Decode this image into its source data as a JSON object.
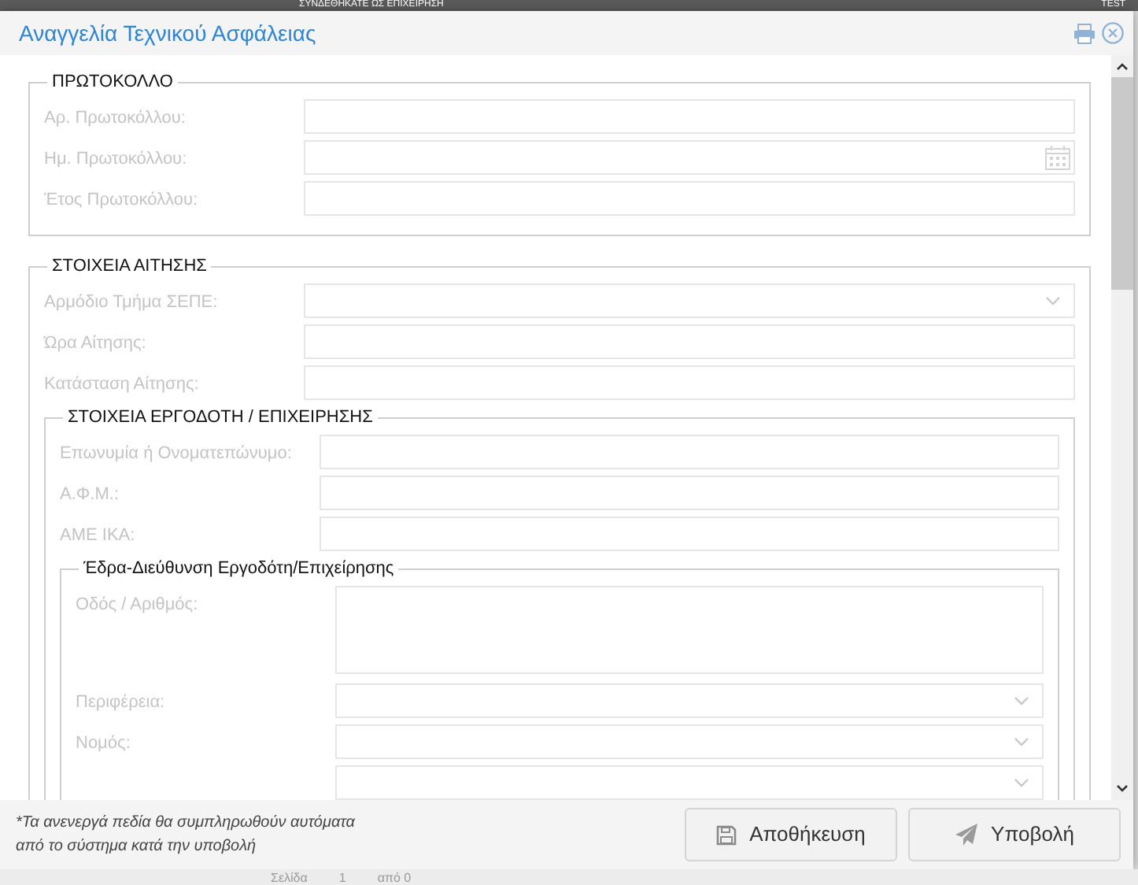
{
  "background": {
    "top_text": "ΣΥΝΔΕΘΗΚΑΤΕ ΩΣ ΕΠΙΧΕΙΡΗΣΗ",
    "top_right_text": "TEST",
    "pager": {
      "page_label": "Σελίδα",
      "page": "1",
      "of": "από 0"
    }
  },
  "window": {
    "title": "Αναγγελία Τεχνικού Ασφάλειας"
  },
  "sections": [
    {
      "legend": "ΠΡΩΤΟΚΟΛΛΟ",
      "fields": [
        {
          "label": "Αρ. Πρωτοκόλλου:",
          "kind": "text",
          "disabled": true
        },
        {
          "label": "Ημ. Πρωτοκόλλου:",
          "kind": "date",
          "disabled": true
        },
        {
          "label": "Έτος Πρωτοκόλλου:",
          "kind": "text",
          "disabled": true
        }
      ]
    },
    {
      "legend": "ΣΤΟΙΧΕΙΑ ΑΙΤΗΣΗΣ",
      "fields": [
        {
          "label": "Αρμόδιο Τμήμα ΣΕΠΕ:",
          "kind": "select",
          "disabled": true
        },
        {
          "label": "Ώρα Αίτησης:",
          "kind": "text",
          "disabled": true
        },
        {
          "label": "Κατάσταση Αίτησης:",
          "kind": "text",
          "disabled": true
        }
      ],
      "children": [
        {
          "legend": "ΣΤΟΙΧΕΙΑ ΕΡΓΟΔΟΤΗ / ΕΠΙΧΕΙΡΗΣΗΣ",
          "fields": [
            {
              "label": "Επωνυμία ή Ονοματεπώνυμο:",
              "kind": "text",
              "disabled": true
            },
            {
              "label": "Α.Φ.Μ.:",
              "kind": "text",
              "disabled": true
            },
            {
              "label": "ΑΜΕ ΙΚΑ:",
              "kind": "text",
              "disabled": true
            }
          ],
          "children": [
            {
              "legend": "Έδρα-Διεύθυνση Εργοδότη/Επιχείρησης",
              "fields": [
                {
                  "label": "Οδός / Αριθμός:",
                  "kind": "textarea",
                  "disabled": true
                },
                {
                  "label": "Περιφέρεια:",
                  "kind": "select",
                  "disabled": true
                },
                {
                  "label": "Νομός:",
                  "kind": "select",
                  "disabled": true
                },
                {
                  "kind": "select",
                  "disabled": true
                }
              ]
            }
          ]
        }
      ]
    }
  ],
  "footer": {
    "note_lines": [
      "*Τα ανενεργά πεδία θα συμπληρωθούν αυτόματα",
      "από το σύστημα κατά την υποβολή"
    ],
    "buttons": [
      {
        "label": "Αποθήκευση",
        "kind": "save"
      },
      {
        "label": "Υποβολή",
        "kind": "submit"
      }
    ]
  }
}
